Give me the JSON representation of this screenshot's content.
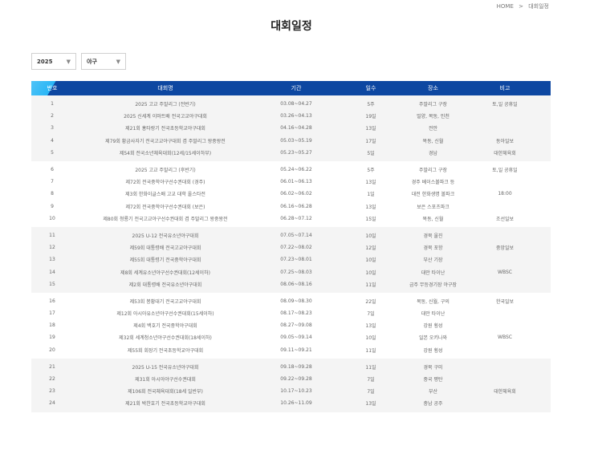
{
  "breadcrumb": {
    "home": "HOME",
    "separator": ">",
    "current": "대회일정"
  },
  "page_title": "대회일정",
  "filters": {
    "year": "2025",
    "sport": "야구"
  },
  "table": {
    "headers": [
      "번호",
      "대회명",
      "기간",
      "일수",
      "장소",
      "비고"
    ],
    "groups": [
      [
        [
          "1",
          "2025 고교 주말리그 (전반기)",
          "03.08~04.27",
          "5주",
          "주말리그 구장",
          "토,일 공휴일"
        ],
        [
          "2",
          "2025 신세계 이마트배 전국고교야구대회",
          "03.26~04.13",
          "19일",
          "밀양, 목동, 인천",
          ""
        ],
        [
          "3",
          "제21회 홍타랑기 전국초등학교야구대회",
          "04.16~04.28",
          "13일",
          "전안",
          ""
        ],
        [
          "4",
          "제79회 황금사자기 전국고교야구대회 겸 주말리그 왕중왕전",
          "05.03~05.19",
          "17일",
          "목동, 신월",
          "동아일보"
        ],
        [
          "5",
          "제54회 전국소년체육대회(12세/15세이하부)",
          "05.23~05.27",
          "5일",
          "경남",
          "대한체육회"
        ]
      ],
      [
        [
          "6",
          "2025 고교 주말리그 (후반기)",
          "05.24~06.22",
          "5주",
          "주말리그 구장",
          "토,일 공휴일"
        ],
        [
          "7",
          "제72회 전국중학야구선수권대회 (경주)",
          "06.01~06.13",
          "13일",
          "경주 베이스볼파크 등",
          ""
        ],
        [
          "8",
          "제3회 한화이글스배 고교 대학 올스타전",
          "06.02~06.02",
          "1일",
          "대전 한화생명 볼파크",
          "18:00"
        ],
        [
          "9",
          "제72회 전국중학야구선수권대회 (보은)",
          "06.16~06.28",
          "13일",
          "보은 스포츠파크",
          ""
        ],
        [
          "10",
          "제80회 청룡기 전국고교야구선수권대회 겸 주말리그 왕중왕전",
          "06.28~07.12",
          "15일",
          "목동, 신월",
          "조선일보"
        ]
      ],
      [
        [
          "11",
          "2025 U-12 전국유소년야구대회",
          "07.05~07.14",
          "10일",
          "경북 울진",
          ""
        ],
        [
          "12",
          "제59회 대통령배 전국고교야구대회",
          "07.22~08.02",
          "12일",
          "경북 포항",
          "중앙일보"
        ],
        [
          "13",
          "제55회 대통령기 전국중학야구대회",
          "07.23~08.01",
          "10일",
          "부산 기장",
          ""
        ],
        [
          "14",
          "제8회 세계유소년야구선수권대회(12세이하)",
          "07.25~08.03",
          "10일",
          "대만 타이난",
          "WBSC"
        ],
        [
          "15",
          "제2회 대통령배 전국유소년야구대회",
          "08.06~08.16",
          "11일",
          "금주 무등경기장 야구장",
          ""
        ]
      ],
      [
        [
          "16",
          "제53회 봉황대기 전국고교야구대회",
          "08.09~08.30",
          "22일",
          "목동, 신월, 구의",
          "한국일보"
        ],
        [
          "17",
          "제12회 아시아유소년야구선수권대회(15세이하)",
          "08.17~08.23",
          "7일",
          "대만 타이난",
          ""
        ],
        [
          "18",
          "제4회 백호기 전국중학야구대회",
          "08.27~09.08",
          "13일",
          "강원 횡성",
          ""
        ],
        [
          "19",
          "제32회 세계청소년야구선수권대회(18세이하)",
          "09.05~09.14",
          "10일",
          "일본 오키나와",
          "WBSC"
        ],
        [
          "20",
          "제55회 회장기 전국초등학교야구대회",
          "09.11~09.21",
          "11일",
          "강원 횡성",
          ""
        ]
      ],
      [
        [
          "21",
          "2025 U-15 전국유소년야구대회",
          "09.18~09.28",
          "11일",
          "경북 구미",
          ""
        ],
        [
          "22",
          "제31회 아시아야구선수권대회",
          "09.22~09.28",
          "7일",
          "중국 평탄",
          ""
        ],
        [
          "23",
          "제106회 전국체육대회(18세 일반부)",
          "10.17~10.23",
          "7일",
          "부산",
          "대한체육회"
        ],
        [
          "24",
          "제21회 박찬호기 전국초등학교야구대회",
          "10.26~11.09",
          "13일",
          "충남 공주",
          ""
        ]
      ]
    ]
  },
  "colors": {
    "header_bg": "#0d47a1",
    "header_accent": "#4fc3f7",
    "shaded_group": "#f4f4f4"
  }
}
